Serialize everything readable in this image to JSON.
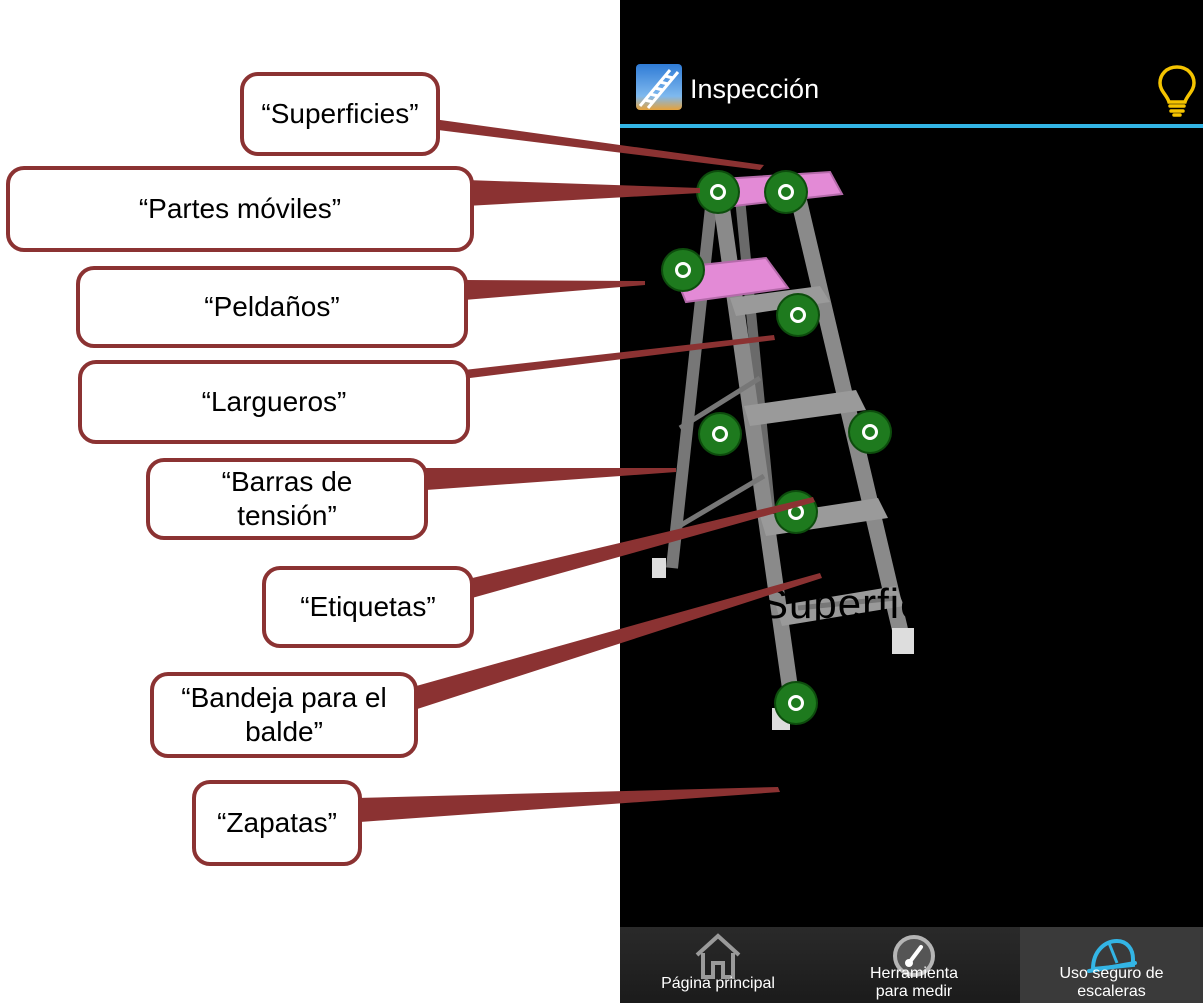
{
  "app": {
    "title": "Inspección"
  },
  "ladder": {
    "center_label": "Superficies"
  },
  "bottom_nav": [
    {
      "label": "Página principal",
      "icon": "home-icon",
      "selected": false
    },
    {
      "label": "Herramienta para medir",
      "icon": "gauge-icon",
      "selected": false
    },
    {
      "label": "Uso seguro de escaleras",
      "icon": "hard-hat-icon",
      "selected": true
    }
  ],
  "callouts": [
    {
      "label": "“Superficies”"
    },
    {
      "label": "“Partes móviles”"
    },
    {
      "label": "“Peldaños”"
    },
    {
      "label": "“Largueros”"
    },
    {
      "label": "“Barras de tensión”"
    },
    {
      "label": "“Etiquetas”"
    },
    {
      "label": "“Bandeja para el balde”"
    },
    {
      "label": "“Zapatas”"
    }
  ],
  "colors": {
    "accent_line": "#33b5e5",
    "callout_border": "#8b3232",
    "hotspot": "#1e7a1e",
    "ladder_top": "#e38ad6"
  }
}
